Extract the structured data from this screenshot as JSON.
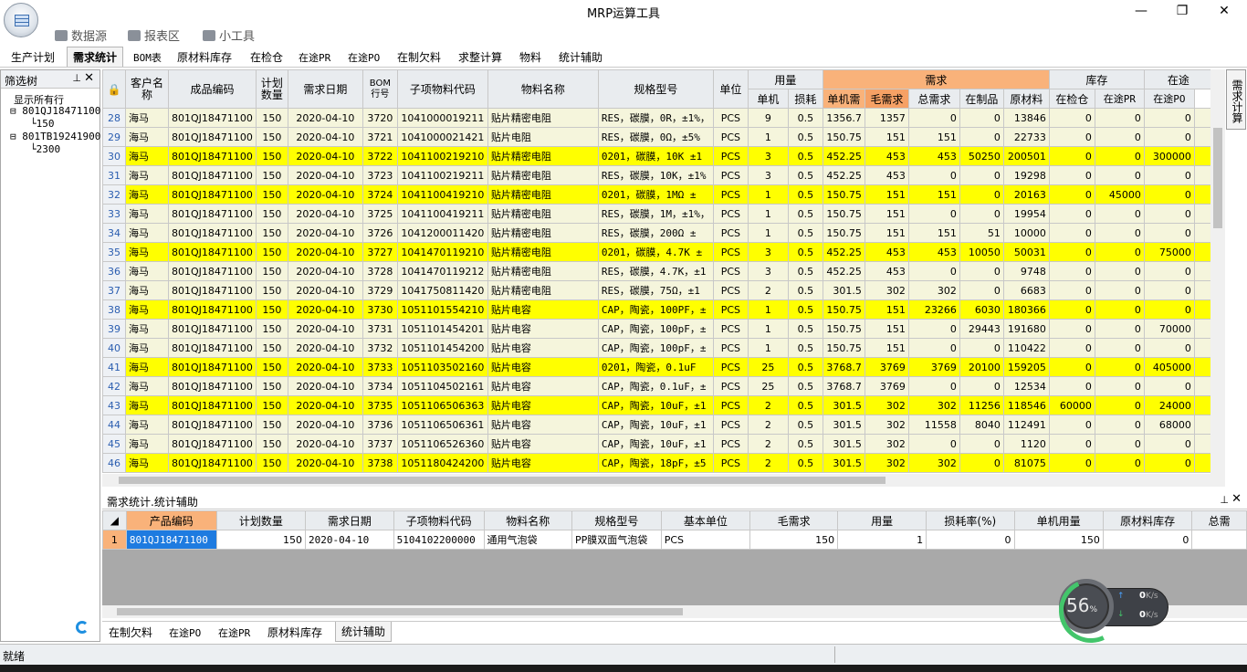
{
  "window": {
    "title": "MRP运算工具"
  },
  "quick_access": [
    {
      "label": "数据源",
      "icon": "database-icon"
    },
    {
      "label": "报表区",
      "icon": "report-icon"
    },
    {
      "label": "小工具",
      "icon": "tools-icon"
    }
  ],
  "menu": [
    "生产计划",
    "需求统计",
    "BOM表",
    "原材料库存",
    "在检仓",
    "在途PR",
    "在途PO",
    "在制欠料",
    "求整计算",
    "物料",
    "统计辅助"
  ],
  "active_menu": "需求统计",
  "left_panel": {
    "title": "筛选树",
    "items": [
      "显示所有行",
      "801QJ18471100",
      "150",
      "801TB19241900",
      "2300"
    ]
  },
  "side_tab": "需求计算",
  "grid": {
    "group_headers": {
      "usage": "用量",
      "demand": "需求",
      "stock": "库存",
      "transit": "在途"
    },
    "columns": {
      "customer": "客户名称",
      "product_code": "成品编码",
      "plan_qty": "计划数量",
      "demand_date": "需求日期",
      "bom_row": "BOM行号",
      "sub_code": "子项物料代码",
      "material_name": "物料名称",
      "spec": "规格型号",
      "unit": "单位",
      "per_unit": "单机",
      "loss": "损耗",
      "unit_demand": "单机需",
      "gross": "毛需求",
      "total": "总需求",
      "wip": "在制品",
      "raw": "原材料",
      "inspect": "在检仓",
      "pr": "在途PR",
      "po": "在途PO",
      "more": "单"
    },
    "rows": [
      {
        "n": "28",
        "y": false,
        "c": "海马",
        "p": "801QJ18471100",
        "q": "150",
        "d": "2020-04-10",
        "b": "3720",
        "s": "1041000019211",
        "m": "贴片精密电阻",
        "sp": "RES，碳膜，0R，±1%，",
        "u": "PCS",
        "pu": "9",
        "l": "0.5",
        "ud": "1356.7",
        "g": "1357",
        "t": "0",
        "w": "0",
        "r": "13846",
        "i": "0",
        "pr": "0",
        "po": "0"
      },
      {
        "n": "29",
        "y": false,
        "c": "海马",
        "p": "801QJ18471100",
        "q": "150",
        "d": "2020-04-10",
        "b": "3721",
        "s": "1041000021421",
        "m": "贴片电阻",
        "sp": "RES，碳膜，0Ω，±5%",
        "u": "PCS",
        "pu": "1",
        "l": "0.5",
        "ud": "150.75",
        "g": "151",
        "t": "151",
        "w": "0",
        "r": "22733",
        "i": "0",
        "pr": "0",
        "po": "0"
      },
      {
        "n": "30",
        "y": true,
        "c": "海马",
        "p": "801QJ18471100",
        "q": "150",
        "d": "2020-04-10",
        "b": "3722",
        "s": "1041100219210",
        "m": "贴片精密电阻",
        "sp": "0201，碳膜，10K ±1",
        "u": "PCS",
        "pu": "3",
        "l": "0.5",
        "ud": "452.25",
        "g": "453",
        "t": "453",
        "w": "50250",
        "r": "200501",
        "i": "0",
        "pr": "0",
        "po": "300000"
      },
      {
        "n": "31",
        "y": false,
        "c": "海马",
        "p": "801QJ18471100",
        "q": "150",
        "d": "2020-04-10",
        "b": "3723",
        "s": "1041100219211",
        "m": "贴片精密电阻",
        "sp": "RES，碳膜，10K，±1%",
        "u": "PCS",
        "pu": "3",
        "l": "0.5",
        "ud": "452.25",
        "g": "453",
        "t": "0",
        "w": "0",
        "r": "19298",
        "i": "0",
        "pr": "0",
        "po": "0"
      },
      {
        "n": "32",
        "y": true,
        "c": "海马",
        "p": "801QJ18471100",
        "q": "150",
        "d": "2020-04-10",
        "b": "3724",
        "s": "1041100419210",
        "m": "贴片精密电阻",
        "sp": "0201，碳膜，1MΩ ±",
        "u": "PCS",
        "pu": "1",
        "l": "0.5",
        "ud": "150.75",
        "g": "151",
        "t": "151",
        "w": "0",
        "r": "20163",
        "i": "0",
        "pr": "45000",
        "po": "0"
      },
      {
        "n": "33",
        "y": false,
        "c": "海马",
        "p": "801QJ18471100",
        "q": "150",
        "d": "2020-04-10",
        "b": "3725",
        "s": "1041100419211",
        "m": "贴片精密电阻",
        "sp": "RES，碳膜，1M，±1%，",
        "u": "PCS",
        "pu": "1",
        "l": "0.5",
        "ud": "150.75",
        "g": "151",
        "t": "0",
        "w": "0",
        "r": "19954",
        "i": "0",
        "pr": "0",
        "po": "0"
      },
      {
        "n": "34",
        "y": false,
        "c": "海马",
        "p": "801QJ18471100",
        "q": "150",
        "d": "2020-04-10",
        "b": "3726",
        "s": "1041200011420",
        "m": "贴片精密电阻",
        "sp": "RES，碳膜，200Ω ±",
        "u": "PCS",
        "pu": "1",
        "l": "0.5",
        "ud": "150.75",
        "g": "151",
        "t": "151",
        "w": "51",
        "r": "10000",
        "i": "0",
        "pr": "0",
        "po": "0"
      },
      {
        "n": "35",
        "y": true,
        "c": "海马",
        "p": "801QJ18471100",
        "q": "150",
        "d": "2020-04-10",
        "b": "3727",
        "s": "1041470119210",
        "m": "贴片精密电阻",
        "sp": "0201，碳膜，4.7K ±",
        "u": "PCS",
        "pu": "3",
        "l": "0.5",
        "ud": "452.25",
        "g": "453",
        "t": "453",
        "w": "10050",
        "r": "50031",
        "i": "0",
        "pr": "0",
        "po": "75000"
      },
      {
        "n": "36",
        "y": false,
        "c": "海马",
        "p": "801QJ18471100",
        "q": "150",
        "d": "2020-04-10",
        "b": "3728",
        "s": "1041470119212",
        "m": "贴片精密电阻",
        "sp": "RES，碳膜，4.7K，±1",
        "u": "PCS",
        "pu": "3",
        "l": "0.5",
        "ud": "452.25",
        "g": "453",
        "t": "0",
        "w": "0",
        "r": "9748",
        "i": "0",
        "pr": "0",
        "po": "0"
      },
      {
        "n": "37",
        "y": false,
        "c": "海马",
        "p": "801QJ18471100",
        "q": "150",
        "d": "2020-04-10",
        "b": "3729",
        "s": "1041750811420",
        "m": "贴片精密电阻",
        "sp": "RES，碳膜，75Ω，±1",
        "u": "PCS",
        "pu": "2",
        "l": "0.5",
        "ud": "301.5",
        "g": "302",
        "t": "302",
        "w": "0",
        "r": "6683",
        "i": "0",
        "pr": "0",
        "po": "0"
      },
      {
        "n": "38",
        "y": true,
        "c": "海马",
        "p": "801QJ18471100",
        "q": "150",
        "d": "2020-04-10",
        "b": "3730",
        "s": "1051101554210",
        "m": "贴片电容",
        "sp": "CAP，陶瓷，100PF，±",
        "u": "PCS",
        "pu": "1",
        "l": "0.5",
        "ud": "150.75",
        "g": "151",
        "t": "23266",
        "w": "6030",
        "r": "180366",
        "i": "0",
        "pr": "0",
        "po": "0"
      },
      {
        "n": "39",
        "y": false,
        "c": "海马",
        "p": "801QJ18471100",
        "q": "150",
        "d": "2020-04-10",
        "b": "3731",
        "s": "1051101454201",
        "m": "贴片电容",
        "sp": "CAP，陶瓷，100pF，±",
        "u": "PCS",
        "pu": "1",
        "l": "0.5",
        "ud": "150.75",
        "g": "151",
        "t": "0",
        "w": "29443",
        "r": "191680",
        "i": "0",
        "pr": "0",
        "po": "70000"
      },
      {
        "n": "40",
        "y": false,
        "c": "海马",
        "p": "801QJ18471100",
        "q": "150",
        "d": "2020-04-10",
        "b": "3732",
        "s": "1051101454200",
        "m": "贴片电容",
        "sp": "CAP，陶瓷，100pF，±",
        "u": "PCS",
        "pu": "1",
        "l": "0.5",
        "ud": "150.75",
        "g": "151",
        "t": "0",
        "w": "0",
        "r": "110422",
        "i": "0",
        "pr": "0",
        "po": "0"
      },
      {
        "n": "41",
        "y": true,
        "c": "海马",
        "p": "801QJ18471100",
        "q": "150",
        "d": "2020-04-10",
        "b": "3733",
        "s": "1051103502160",
        "m": "贴片电容",
        "sp": "0201，陶瓷，0.1uF",
        "u": "PCS",
        "pu": "25",
        "l": "0.5",
        "ud": "3768.7",
        "g": "3769",
        "t": "3769",
        "w": "20100",
        "r": "159205",
        "i": "0",
        "pr": "0",
        "po": "405000"
      },
      {
        "n": "42",
        "y": false,
        "c": "海马",
        "p": "801QJ18471100",
        "q": "150",
        "d": "2020-04-10",
        "b": "3734",
        "s": "1051104502161",
        "m": "贴片电容",
        "sp": "CAP，陶瓷，0.1uF，±",
        "u": "PCS",
        "pu": "25",
        "l": "0.5",
        "ud": "3768.7",
        "g": "3769",
        "t": "0",
        "w": "0",
        "r": "12534",
        "i": "0",
        "pr": "0",
        "po": "0"
      },
      {
        "n": "43",
        "y": true,
        "c": "海马",
        "p": "801QJ18471100",
        "q": "150",
        "d": "2020-04-10",
        "b": "3735",
        "s": "1051106506363",
        "m": "贴片电容",
        "sp": "CAP，陶瓷，10uF，±1",
        "u": "PCS",
        "pu": "2",
        "l": "0.5",
        "ud": "301.5",
        "g": "302",
        "t": "302",
        "w": "11256",
        "r": "118546",
        "i": "60000",
        "pr": "0",
        "po": "24000"
      },
      {
        "n": "44",
        "y": false,
        "c": "海马",
        "p": "801QJ18471100",
        "q": "150",
        "d": "2020-04-10",
        "b": "3736",
        "s": "1051106506361",
        "m": "贴片电容",
        "sp": "CAP，陶瓷，10uF，±1",
        "u": "PCS",
        "pu": "2",
        "l": "0.5",
        "ud": "301.5",
        "g": "302",
        "t": "11558",
        "w": "8040",
        "r": "112491",
        "i": "0",
        "pr": "0",
        "po": "68000"
      },
      {
        "n": "45",
        "y": false,
        "c": "海马",
        "p": "801QJ18471100",
        "q": "150",
        "d": "2020-04-10",
        "b": "3737",
        "s": "1051106526360",
        "m": "贴片电容",
        "sp": "CAP，陶瓷，10uF，±1",
        "u": "PCS",
        "pu": "2",
        "l": "0.5",
        "ud": "301.5",
        "g": "302",
        "t": "0",
        "w": "0",
        "r": "1120",
        "i": "0",
        "pr": "0",
        "po": "0"
      },
      {
        "n": "46",
        "y": true,
        "c": "海马",
        "p": "801QJ18471100",
        "q": "150",
        "d": "2020-04-10",
        "b": "3738",
        "s": "1051180424200",
        "m": "贴片电容",
        "sp": "CAP，陶瓷，18pF，±5",
        "u": "PCS",
        "pu": "2",
        "l": "0.5",
        "ud": "301.5",
        "g": "302",
        "t": "302",
        "w": "0",
        "r": "81075",
        "i": "0",
        "pr": "0",
        "po": "0"
      }
    ]
  },
  "sub_panel": {
    "title": "需求统计.统计辅助",
    "columns": [
      "产品编码",
      "计划数量",
      "需求日期",
      "子项物料代码",
      "物料名称",
      "规格型号",
      "基本单位",
      "毛需求",
      "用量",
      "损耗率(%)",
      "单机用量",
      "原材料库存",
      "总需"
    ],
    "rows": [
      {
        "n": "1",
        "p": "801QJ18471100",
        "q": "150",
        "d": "2020-04-10",
        "s": "5104102200000",
        "m": "通用气泡袋",
        "sp": "PP膜双面气泡袋",
        "u": "PCS",
        "g": "150",
        "use": "1",
        "loss": "0",
        "pu": "150",
        "raw": "0",
        "tot": ""
      }
    ]
  },
  "bottom_tabs": [
    "在制欠料",
    "在途PO",
    "在途PR",
    "原材料库存",
    "统计辅助"
  ],
  "status": "就绪",
  "monitor": {
    "percent": "56",
    "unit": "%",
    "up": "0",
    "down": "0",
    "speed_unit": "K/s"
  }
}
